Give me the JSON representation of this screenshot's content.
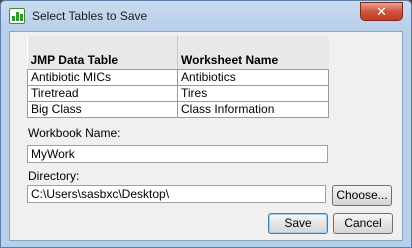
{
  "window": {
    "title": "Select Tables to Save",
    "close_glyph": "✕"
  },
  "table": {
    "headers": [
      "JMP Data Table",
      "Worksheet Name"
    ],
    "rows": [
      [
        "Antibiotic MICs",
        "Antibiotics"
      ],
      [
        "Tiretread",
        "Tires"
      ],
      [
        "Big Class",
        "Class Information"
      ]
    ]
  },
  "workbook": {
    "label": "Workbook Name:",
    "value": "MyWork"
  },
  "directory": {
    "label": "Directory:",
    "value": "C:\\Users\\sasbxc\\Desktop\\",
    "choose_label": "Choose..."
  },
  "buttons": {
    "save_label": "Save",
    "cancel_label": "Cancel"
  }
}
